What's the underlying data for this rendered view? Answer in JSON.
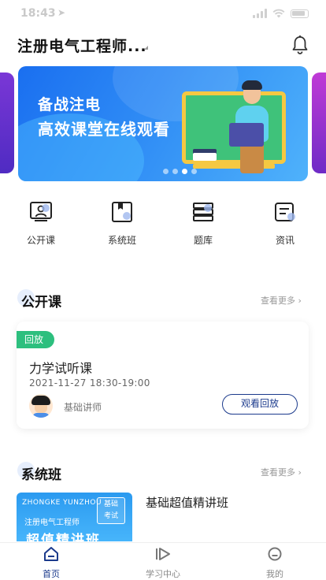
{
  "status_bar": {
    "time": "18:43",
    "location_glyph": "➤"
  },
  "header": {
    "title": "注册电气工程师...",
    "bell_icon": "bell-icon"
  },
  "banner": {
    "line1": "备战注电",
    "line2": "高效课堂在线观看",
    "slides": 4,
    "active_slide_index": 2
  },
  "quick_nav": [
    {
      "label": "公开课",
      "icon": "live-class-icon"
    },
    {
      "label": "系统班",
      "icon": "course-book-icon"
    },
    {
      "label": "题库",
      "icon": "question-bank-icon"
    },
    {
      "label": "资讯",
      "icon": "news-icon"
    }
  ],
  "public_class": {
    "title": "公开课",
    "more": "查看更多 ›",
    "card": {
      "badge": "回放",
      "title": "力学试听课",
      "datetime": "2021-11-27   18:30-19:00",
      "teacher": "基础讲师",
      "button": "观看回放"
    }
  },
  "system_class": {
    "title": "系统班",
    "more": "查看更多 ›",
    "course": {
      "thumb_en": "ZHONGKE YUNZHOU",
      "thumb_cn": "注册电气工程师",
      "thumb_tag_line1": "基础",
      "thumb_tag_line2": "考试",
      "thumb_big": "超值精讲班",
      "name": "基础超值精讲班"
    }
  },
  "tabbar": [
    {
      "label": "首页",
      "icon": "home-icon",
      "active": true
    },
    {
      "label": "学习中心",
      "icon": "study-center-icon",
      "active": false
    },
    {
      "label": "我的",
      "icon": "profile-icon",
      "active": false
    }
  ],
  "colors": {
    "accent": "#1b3a8c",
    "badge": "#2dbf7e",
    "banner_start": "#1a6ff0",
    "banner_end": "#4fb2fb"
  }
}
